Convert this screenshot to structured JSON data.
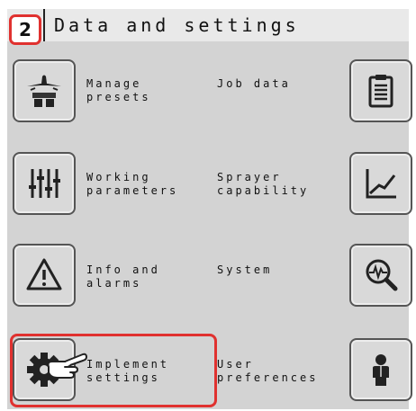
{
  "header": {
    "step_number": "2",
    "title": "Data and settings"
  },
  "menu": {
    "items": [
      {
        "label_line1": "Manage",
        "label_line2": "presets",
        "icon": "manage-presets-icon"
      },
      {
        "label_line1": "Job data",
        "label_line2": "",
        "icon": "clipboard-icon"
      },
      {
        "label_line1": "Working",
        "label_line2": "parameters",
        "icon": "sliders-icon"
      },
      {
        "label_line1": "Sprayer",
        "label_line2": "capability",
        "icon": "chart-line-icon"
      },
      {
        "label_line1": "Info and",
        "label_line2": "alarms",
        "icon": "warning-icon"
      },
      {
        "label_line1": "System",
        "label_line2": "",
        "icon": "magnifier-pulse-icon"
      },
      {
        "label_line1": "Implement",
        "label_line2": "settings",
        "icon": "gear-icon"
      },
      {
        "label_line1": "User",
        "label_line2": "preferences",
        "icon": "user-icon"
      }
    ],
    "highlighted_item": "Implement settings"
  },
  "colors": {
    "highlight": "#e0312f",
    "screen_bg": "#d3d3d3",
    "header_bg": "#e9e9e9"
  }
}
